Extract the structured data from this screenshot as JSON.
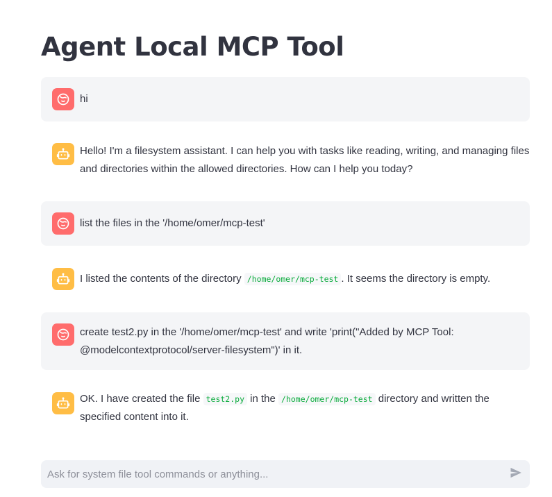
{
  "app": {
    "title": "Agent Local MCP Tool"
  },
  "messages": [
    {
      "role": "user",
      "avatar_icon": "user-face-icon",
      "parts": [
        {
          "type": "text",
          "value": "hi"
        }
      ]
    },
    {
      "role": "assistant",
      "avatar_icon": "robot-icon",
      "parts": [
        {
          "type": "text",
          "value": "Hello! I'm a filesystem assistant. I can help you with tasks like reading, writing, and managing files and directories within the allowed directories. How can I help you today?"
        }
      ]
    },
    {
      "role": "user",
      "avatar_icon": "user-face-icon",
      "parts": [
        {
          "type": "text",
          "value": "list the files in the '/home/omer/mcp-test'"
        }
      ]
    },
    {
      "role": "assistant",
      "avatar_icon": "robot-icon",
      "parts": [
        {
          "type": "text",
          "value": "I listed the contents of the directory "
        },
        {
          "type": "code",
          "value": "/home/omer/mcp-test"
        },
        {
          "type": "text",
          "value": ". It seems the directory is empty."
        }
      ]
    },
    {
      "role": "user",
      "avatar_icon": "user-face-icon",
      "parts": [
        {
          "type": "text",
          "value": "create test2.py in the '/home/omer/mcp-test' and write 'print(\"Added by MCP Tool: @modelcontextprotocol/server-filesystem\")' in it."
        }
      ]
    },
    {
      "role": "assistant",
      "avatar_icon": "robot-icon",
      "parts": [
        {
          "type": "text",
          "value": "OK. I have created the file "
        },
        {
          "type": "code",
          "value": "test2.py"
        },
        {
          "type": "text",
          "value": " in the "
        },
        {
          "type": "code",
          "value": "/home/omer/mcp-test"
        },
        {
          "type": "text",
          "value": " directory and written the specified content into it."
        }
      ]
    }
  ],
  "chat_input": {
    "placeholder": "Ask for system file tool commands or anything...",
    "value": "",
    "send_icon": "send-icon"
  },
  "colors": {
    "user_avatar": "#ff6c6c",
    "assistant_avatar": "#ffbd45",
    "user_bubble": "#f4f5f7",
    "code_text": "#09ab3b",
    "text": "#31333f"
  }
}
